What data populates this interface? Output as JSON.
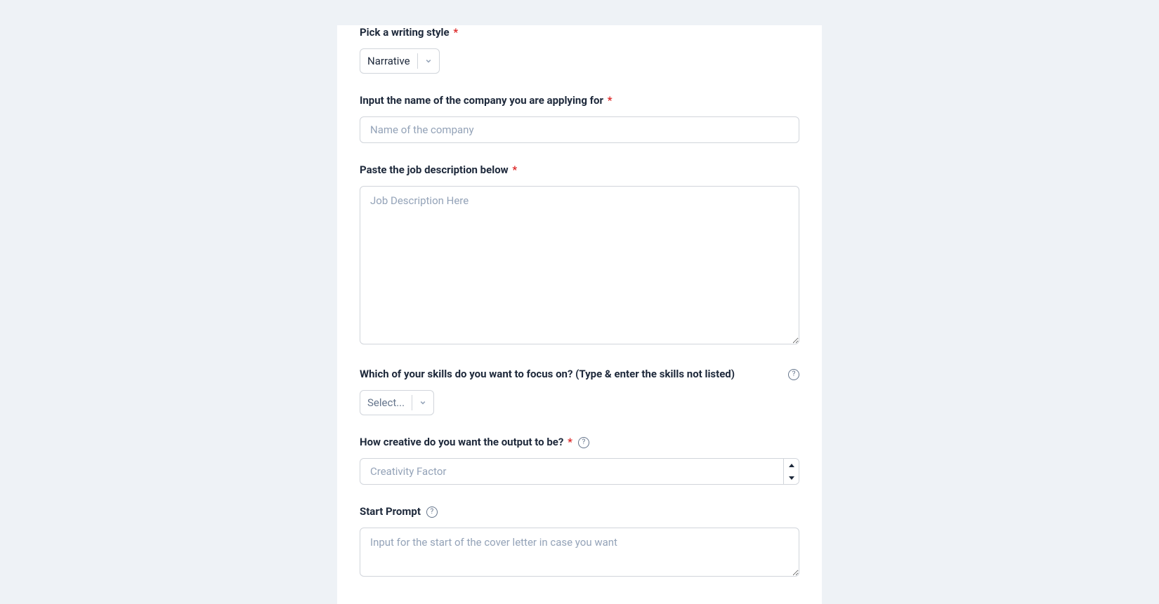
{
  "form": {
    "writing_style": {
      "label": "Pick a writing style",
      "required": true,
      "selected": "Narrative"
    },
    "company_name": {
      "label": "Input the name of the company you are applying for",
      "required": true,
      "placeholder": "Name of the company",
      "value": ""
    },
    "job_description": {
      "label": "Paste the job description below",
      "required": true,
      "placeholder": "Job Description Here",
      "value": ""
    },
    "skills": {
      "label": "Which of your skills do you want to focus on? (Type & enter the skills not listed)",
      "has_help": true,
      "placeholder": "Select..."
    },
    "creativity": {
      "label": "How creative do you want the output to be?",
      "required": true,
      "has_help": true,
      "placeholder": "Creativity Factor",
      "value": ""
    },
    "start_prompt": {
      "label": "Start Prompt",
      "has_help": true,
      "placeholder": "Input for the start of the cover letter in case you want",
      "value": ""
    }
  }
}
